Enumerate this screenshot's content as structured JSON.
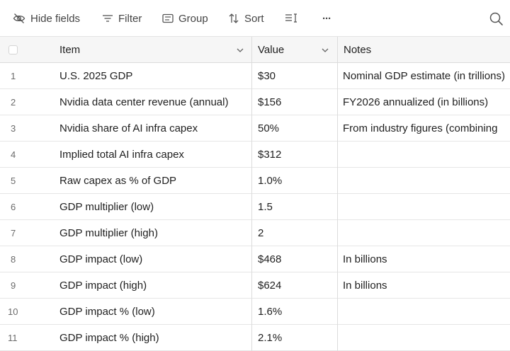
{
  "toolbar": {
    "hide_fields": "Hide fields",
    "filter": "Filter",
    "group": "Group",
    "sort": "Sort",
    "row_height_icon": "row-height-icon",
    "more": "···",
    "search_icon": "search-icon"
  },
  "columns": {
    "item": "Item",
    "value": "Value",
    "notes": "Notes"
  },
  "rows": [
    {
      "num": "1",
      "item": "U.S. 2025 GDP",
      "value": "$30",
      "notes": "Nominal GDP estimate (in trillions)"
    },
    {
      "num": "2",
      "item": "Nvidia data center revenue (annual)",
      "value": "$156",
      "notes": "FY2026 annualized (in billions)"
    },
    {
      "num": "3",
      "item": "Nvidia share of AI infra capex",
      "value": "50%",
      "notes": "From industry figures (combining"
    },
    {
      "num": "4",
      "item": "Implied total AI infra capex",
      "value": "$312",
      "notes": ""
    },
    {
      "num": "5",
      "item": "Raw capex as % of GDP",
      "value": "1.0%",
      "notes": ""
    },
    {
      "num": "6",
      "item": "GDP multiplier (low)",
      "value": "1.5",
      "notes": ""
    },
    {
      "num": "7",
      "item": "GDP multiplier (high)",
      "value": "2",
      "notes": ""
    },
    {
      "num": "8",
      "item": "GDP impact (low)",
      "value": "$468",
      "notes": "In billions"
    },
    {
      "num": "9",
      "item": "GDP impact (high)",
      "value": "$624",
      "notes": "In billions"
    },
    {
      "num": "10",
      "item": "GDP impact % (low)",
      "value": "1.6%",
      "notes": ""
    },
    {
      "num": "11",
      "item": "GDP impact % (high)",
      "value": "2.1%",
      "notes": ""
    }
  ]
}
